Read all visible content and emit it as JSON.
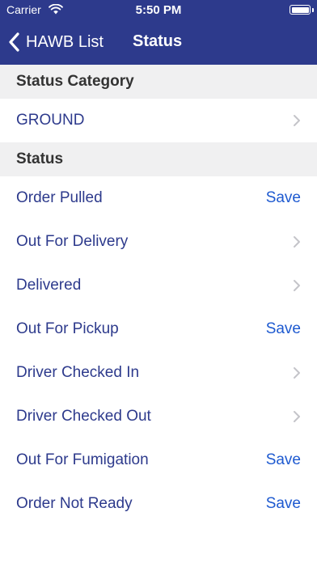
{
  "status_bar": {
    "carrier": "Carrier",
    "time": "5:50 PM"
  },
  "nav": {
    "back_label": "HAWB List",
    "title": "Status"
  },
  "category_section": {
    "header": "Status Category",
    "value": "GROUND"
  },
  "status_section": {
    "header": "Status",
    "items": [
      {
        "label": "Order Pulled",
        "accessory": "Save"
      },
      {
        "label": "Out For Delivery",
        "accessory": "chevron"
      },
      {
        "label": "Delivered",
        "accessory": "chevron"
      },
      {
        "label": "Out For Pickup",
        "accessory": "Save"
      },
      {
        "label": "Driver Checked In",
        "accessory": "chevron"
      },
      {
        "label": "Driver Checked Out",
        "accessory": "chevron"
      },
      {
        "label": "Out For Fumigation",
        "accessory": "Save"
      },
      {
        "label": "Order Not Ready",
        "accessory": "Save"
      }
    ]
  },
  "colors": {
    "nav_background": "#2d3a8c",
    "row_text": "#2d3a8c",
    "save_link": "#1e5ad0",
    "section_background": "#f0f0f1"
  }
}
